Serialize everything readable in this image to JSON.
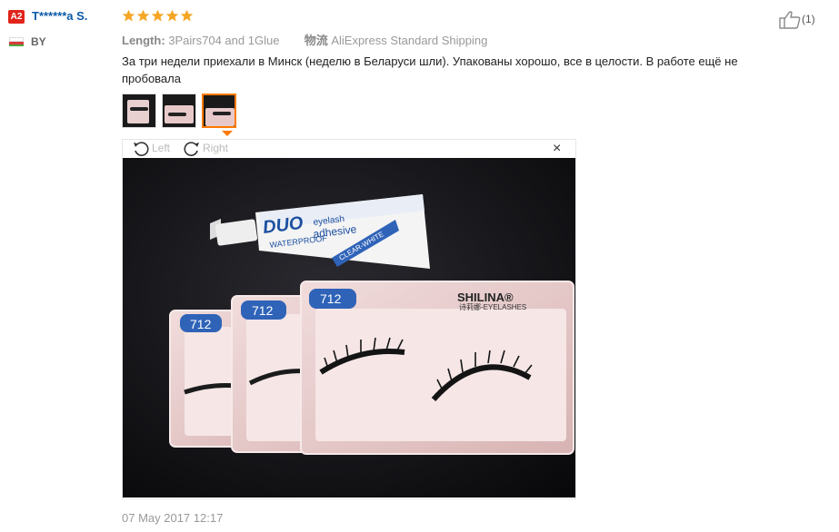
{
  "user": {
    "level": "A2",
    "name": "T******a S.",
    "country": "BY",
    "flag_colors": [
      "#ffffff",
      "#d93a3a",
      "#4aa842"
    ]
  },
  "review": {
    "rating": 5,
    "rating_color": "#f5a623",
    "length_label": "Length:",
    "length_value": "3Pairs704 and 1Glue",
    "logistics_label": "物流",
    "logistics_value": "AliExpress Standard Shipping",
    "text": "За три недели приехали в Минск (неделю в Беларуси шли). Упакованы хорошо, все в целости. В работе ещё не пробовала",
    "date": "07 May 2017 12:17",
    "helpful_count": "(1)"
  },
  "viewer": {
    "rotate_left": "Left",
    "rotate_right": "Right",
    "close": "×",
    "photo": {
      "tube_brand": "DUO",
      "tube_line1": "eyelash",
      "tube_line2": "adhesive",
      "tube_waterproof": "WATERPROOF",
      "tube_color": "CLEAR-WHITE",
      "tray_number": "712",
      "tray_brand": "SHILINA®",
      "tray_sub": "诗莉娜-EYELASHES"
    }
  },
  "thumbnails": [
    {
      "label": "thumb-1",
      "active": false
    },
    {
      "label": "thumb-2",
      "active": false
    },
    {
      "label": "thumb-3",
      "active": true
    }
  ]
}
